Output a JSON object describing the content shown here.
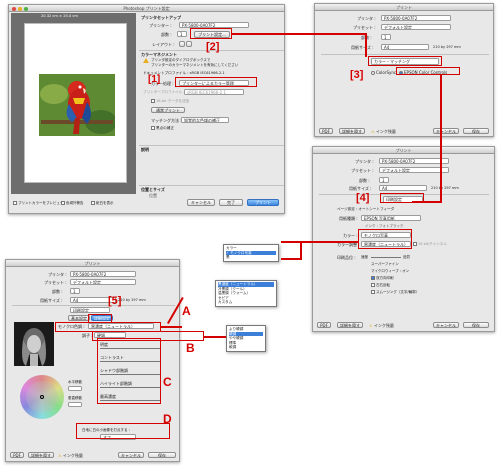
{
  "w1": {
    "title": "Photoshop プリント設定",
    "preview_info": "20.32 cm × 25.4 cm",
    "section": "プリンタセットアップ",
    "printer_label": "プリンター :",
    "printer_value": "PX-5800-0A07F2",
    "copies_label": "部数 :",
    "copies_value": "1",
    "print_settings_btn": "プリント設定...",
    "layout_label": "レイアウト :",
    "cm_header": "カラーマネジメント",
    "warn1": "プリンタ設定のダイアログボックスで",
    "warn2": "プリンターのカラーマネジメントを有効にしてください",
    "doc_profile": "ドキュメントプロファイル : sRGB IEC61966-2.1",
    "color_handling_label": "カラー処理 :",
    "color_handling_value": "プリンターによるカラー管理",
    "printer_profile_label": "プリンタープロファイル :",
    "printer_profile_value": "sRGB IEC61966-2.1",
    "data16": "16-bit データを送信",
    "normal_print": "通常プリント",
    "rendering_label": "マッチング方法 :",
    "rendering_value": "知覚的な色域の補正",
    "bpc": "黒点の補正",
    "description": "説明",
    "position_size": "位置とサイズ",
    "position": "位置",
    "preview_color": "プリントカラーをプレビュー",
    "gamut": "色域外警告",
    "paper_white": "紙白を表示",
    "cancel": "キャンセル",
    "done": "完了",
    "print": "プリント"
  },
  "w2": {
    "title": "プリント",
    "printer_label": "プリンタ :",
    "printer_value": "PX-5800-0A07F2",
    "preset_label": "プリセット :",
    "preset_value": "デフォルト設定",
    "copies_label": "部数 :",
    "copies_value": "1",
    "paper_label": "用紙サイズ :",
    "paper_value": "A4",
    "paper_dims": "210 by 297 mm",
    "menu_value": "カラー・マッチング",
    "colorsync": "ColorSync",
    "epson_cc": "EPSON Color Controls",
    "pdf": "PDF",
    "details": "詳細を隠す",
    "ink": "インク残量",
    "cancel": "キャンセル",
    "print": "保存"
  },
  "w3": {
    "title": "プリント",
    "printer_label": "プリンタ :",
    "printer_value": "PX-5800-0A07F2",
    "preset_label": "プリセット :",
    "preset_value": "デフォルト設定",
    "copies_label": "部数 :",
    "copies_value": "1",
    "paper_label": "用紙サイズ :",
    "paper_value": "A4",
    "paper_dims": "210 by 297 mm",
    "print_settings_tab": "印刷設定",
    "page_setup": "ページ設定 : オートシートフィーダ",
    "media_label": "用紙種類 :",
    "media_value": "EPSON 写真用紙",
    "print_quality": "インク : フォトブラック",
    "color_label": "カラー :",
    "color_value": "モノクロ写真",
    "color_mode_label": "カラー調整 :",
    "color_mode_value": "黒濃度（ニュートラル）",
    "sixteen": "16 bit/チャンネル",
    "print_quality_label": "印刷品位 :",
    "speed": "速度",
    "quality": "品質",
    "super_fine": "スーパーファイン",
    "mf": "マイクロウィーブ : オン",
    "hs": "双方向印刷",
    "mirror": "左右反転",
    "smoothing": "スムージング（文字/輪郭）",
    "pdf": "PDF",
    "details": "詳細を隠す",
    "ink": "インク残量",
    "cancel": "キャンセル",
    "print": "保存"
  },
  "pop_color": {
    "items": [
      "カラー",
      "モノクロ写真",
      "黒"
    ]
  },
  "w4": {
    "title": "プリント",
    "printer_label": "プリンタ :",
    "printer_value": "PX-5800-0A07F2",
    "preset_label": "プリセット :",
    "preset_value": "デフォルト設定",
    "copies_label": "部数 :",
    "copies_value": "1",
    "paper_label": "用紙サイズ :",
    "paper_value": "A4",
    "paper_dims": "210 by 297 mm",
    "settings_tab": "印刷設定",
    "basic_tab": "基本設定",
    "detail_tab": "詳細設定",
    "mono_label": "モノクロ色調 :",
    "mono_value": "黒濃度（ニュートラル）",
    "tone_label": "調子 :",
    "tone_value": "硬調",
    "brightness": "明度",
    "contrast": "コントラスト",
    "shadow": "シャドウ部階調",
    "highlight": "ハイライト部階調",
    "max_density": "最高濃度",
    "h_label": "水平移動",
    "v_label": "垂直移動",
    "white_area_label": "白地に白の小画像を打点する :",
    "white_area_value": "オフ",
    "pdf": "PDF",
    "details": "詳細を隠す",
    "ink": "インク残量",
    "cancel": "キャンセル",
    "print": "保存"
  },
  "pop_a": {
    "items": [
      "黒濃度（ニュートラル）",
      "冷黒調（クール）",
      "温黒調（ウォーム）",
      "セピア",
      "カスタム"
    ]
  },
  "pop_b": {
    "items": [
      "より硬調",
      "硬調",
      "やや硬調",
      "標準",
      "軟調"
    ]
  },
  "steps": {
    "s1": "[1]",
    "s2": "[2]",
    "s3": "[3]",
    "s4": "[4]",
    "s5": "[5]"
  },
  "annotations": {
    "A": "A",
    "B": "B",
    "C": "C",
    "D": "D"
  },
  "colors": {
    "annotation_red": "#d40000",
    "window_bg": "#e8e8e8",
    "selection_blue": "#3c7fd8"
  }
}
